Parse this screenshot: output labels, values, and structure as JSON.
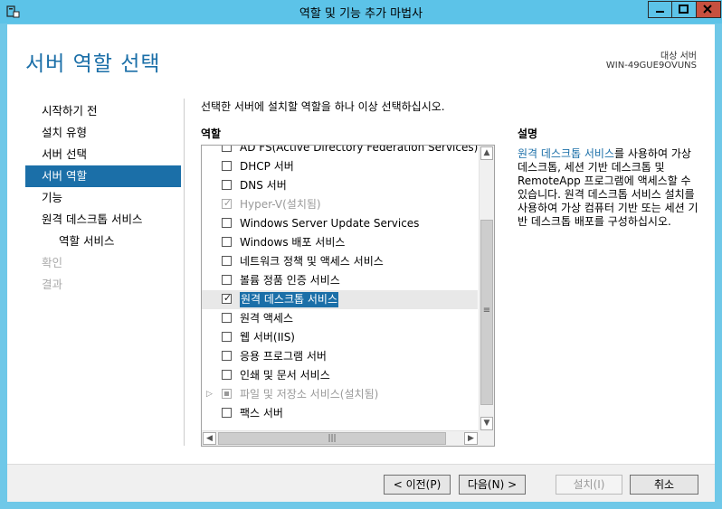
{
  "window": {
    "title": "역할 및 기능 추가 마법사"
  },
  "header": {
    "page_title": "서버 역할 선택",
    "target_label": "대상 서버",
    "target_server": "WIN-49GUE9OVUNS"
  },
  "nav": {
    "items": [
      {
        "label": "시작하기 전"
      },
      {
        "label": "설치 유형"
      },
      {
        "label": "서버 선택"
      },
      {
        "label": "서버 역할"
      },
      {
        "label": "기능"
      },
      {
        "label": "원격 데스크톱 서비스"
      },
      {
        "label": "역할 서비스"
      },
      {
        "label": "확인"
      },
      {
        "label": "결과"
      }
    ]
  },
  "main": {
    "instruction": "선택한 서버에 설치할 역할을 하나 이상 선택하십시오.",
    "roles_header": "역할",
    "roles": [
      {
        "label": "AD FS(Active Directory Federation Services)"
      },
      {
        "label": "DHCP 서버"
      },
      {
        "label": "DNS 서버"
      },
      {
        "label": "Hyper-V(설치됨)"
      },
      {
        "label": "Windows Server Update Services"
      },
      {
        "label": "Windows 배포 서비스"
      },
      {
        "label": "네트워크 정책 및 액세스 서비스"
      },
      {
        "label": "볼륨 정품 인증 서비스"
      },
      {
        "label": "원격 데스크톱 서비스"
      },
      {
        "label": "원격 액세스"
      },
      {
        "label": "웹 서버(IIS)"
      },
      {
        "label": "응용 프로그램 서버"
      },
      {
        "label": "인쇄 및 문서 서비스"
      },
      {
        "label": "파일 및 저장소 서비스(설치됨)"
      },
      {
        "label": "팩스 서버"
      }
    ],
    "description_header": "설명",
    "description_link": "원격 데스크톱 서비스",
    "description_text": "를 사용하여 가상 데스크톱, 세션 기반 데스크톱 및 RemoteApp 프로그램에 액세스할 수 있습니다. 원격 데스크톱 서비스 설치를 사용하여 가상 컴퓨터 기반 또는 세션 기반 데스크톱 배포를 구성하십시오."
  },
  "footer": {
    "prev_label": "< 이전(P)",
    "next_label": "다음(N) >",
    "install_label": "설치(I)",
    "cancel_label": "취소"
  },
  "colors": {
    "accent": "#1b6fa8",
    "titlebar": "#5cc3e8"
  }
}
